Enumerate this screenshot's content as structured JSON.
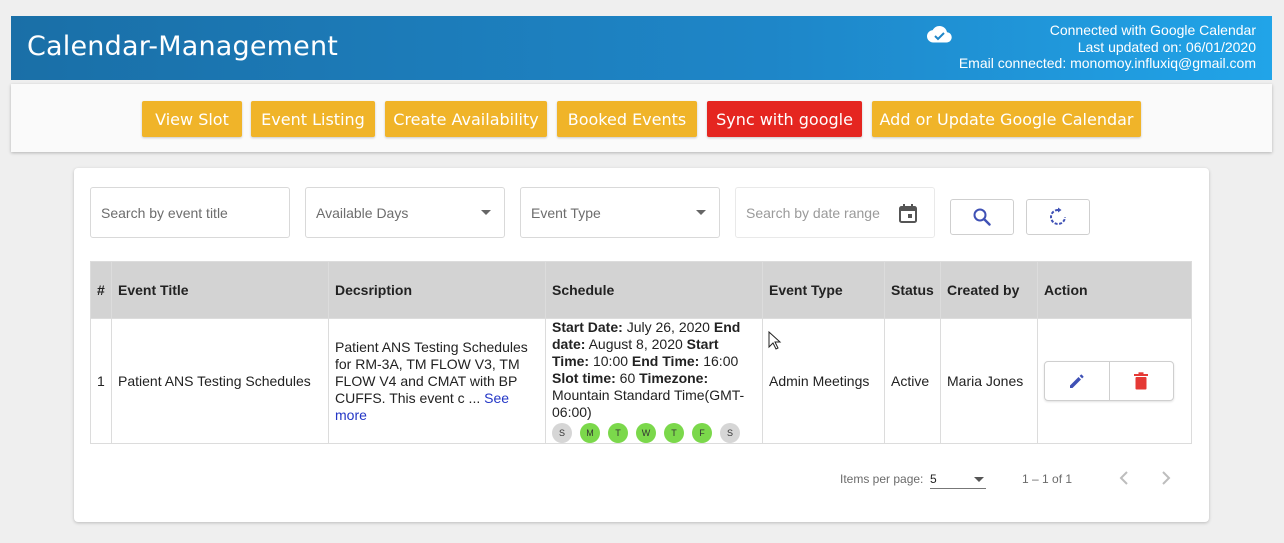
{
  "header": {
    "title": "Calendar-Management",
    "connection": {
      "line1": "Connected with Google Calendar",
      "line2": "Last updated on: 06/01/2020",
      "line3": "Email connected: monomoy.influxiq@gmail.com"
    },
    "cloud_icon": "cloud-check-icon"
  },
  "toolbar": {
    "buttons": [
      {
        "label": "View Slot"
      },
      {
        "label": "Event Listing"
      },
      {
        "label": "Create Availability"
      },
      {
        "label": "Booked Events"
      },
      {
        "label": "Sync with google"
      },
      {
        "label": "Add or Update Google Calendar"
      }
    ],
    "colors": {
      "primary": "#f0b429",
      "danger": "#e52620"
    }
  },
  "filters": {
    "search_title_placeholder": "Search by event title",
    "available_days": "Available Days",
    "event_type": "Event Type",
    "date_range_placeholder": "Search by date range",
    "search_icon": "search-icon",
    "reset_icon": "refresh-icon"
  },
  "table": {
    "headers": [
      "#",
      "Event Title",
      "Decsription",
      "Schedule",
      "Event Type",
      "Status",
      "Created by",
      "Action"
    ],
    "rows": [
      {
        "index": "1",
        "title": "Patient ANS Testing Schedules",
        "description": "Patient ANS Testing Schedules for RM-3A, TM FLOW V3, TM FLOW V4 and CMAT with BP CUFFS. This event c ...",
        "see_more": "See more",
        "schedule": {
          "start_date_label": "Start Date:",
          "start_date": "July 26, 2020",
          "end_date_label": "End date:",
          "end_date": "August 8, 2020",
          "start_time_label": "Start Time:",
          "start_time": "10:00",
          "end_time_label": "End Time:",
          "end_time": "16:00",
          "slot_time_label": "Slot time:",
          "slot_time": "60",
          "timezone_label": "Timezone:",
          "timezone": "Mountain Standard Time(GMT-06:00)",
          "days": [
            {
              "label": "S",
              "active": false
            },
            {
              "label": "M",
              "active": true
            },
            {
              "label": "T",
              "active": true
            },
            {
              "label": "W",
              "active": true
            },
            {
              "label": "T",
              "active": true
            },
            {
              "label": "F",
              "active": true
            },
            {
              "label": "S",
              "active": false
            }
          ]
        },
        "event_type": "Admin Meetings",
        "status": "Active",
        "created_by": "Maria Jones",
        "actions": {
          "edit_icon": "edit-icon",
          "delete_icon": "trash-icon"
        }
      }
    ]
  },
  "paginator": {
    "items_per_page_label": "Items per page:",
    "items_per_page": "5",
    "range": "1 – 1 of 1"
  }
}
